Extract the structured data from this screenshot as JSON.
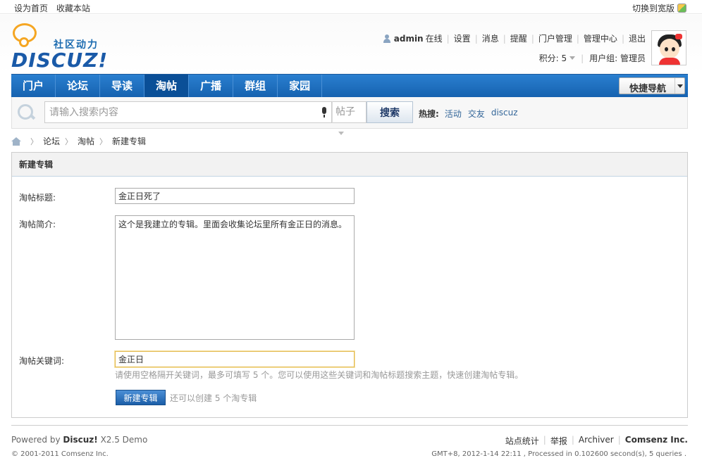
{
  "topbar": {
    "set_home": "设为首页",
    "bookmark": "收藏本站",
    "switch_wide": "切换到宽版"
  },
  "logo": {
    "cn": "社区动力",
    "en": "DISCUZ!"
  },
  "userbar": {
    "username": "admin",
    "status": "在线",
    "links": [
      "设置",
      "消息",
      "提醒",
      "门户管理",
      "管理中心",
      "退出"
    ],
    "credits": "积分: 5",
    "usergroup": "用户组: 管理员"
  },
  "nav": {
    "items": [
      "门户",
      "论坛",
      "导读",
      "淘帖",
      "广播",
      "群组",
      "家园"
    ],
    "active_index": 3,
    "quick": "快捷导航"
  },
  "search": {
    "placeholder": "请输入搜索内容",
    "type": "帖子",
    "button": "搜索",
    "hot_label": "热搜:",
    "hot_terms": [
      "活动",
      "交友",
      "discuz"
    ]
  },
  "breadcrumb": [
    "论坛",
    "淘帖",
    "新建专辑"
  ],
  "form": {
    "title": "新建专辑",
    "name_label": "淘帖标题:",
    "name_value": "金正日死了",
    "desc_label": "淘帖简介:",
    "desc_value": "这个是我建立的专辑。里面会收集论坛里所有金正日的消息。",
    "keyword_label": "淘帖关键词:",
    "keyword_value": "金正日",
    "hint": "请使用空格隔开关键词，最多可填写 5 个。您可以使用这些关键词和淘帖标题搜索主题，快速创建淘帖专辑。",
    "submit": "新建专辑",
    "remain": "还可以创建 5 个淘专辑"
  },
  "footer": {
    "powered_prefix": "Powered by",
    "powered_brand": "Discuz!",
    "powered_version": "X2.5 Demo",
    "copyright": "© 2001-2011 Comsenz Inc.",
    "links": [
      "站点统计",
      "举报",
      "Archiver"
    ],
    "company": "Comsenz Inc.",
    "debug": "GMT+8, 2012-1-14 22:11 , Processed in 0.102600 second(s), 5 queries ."
  }
}
